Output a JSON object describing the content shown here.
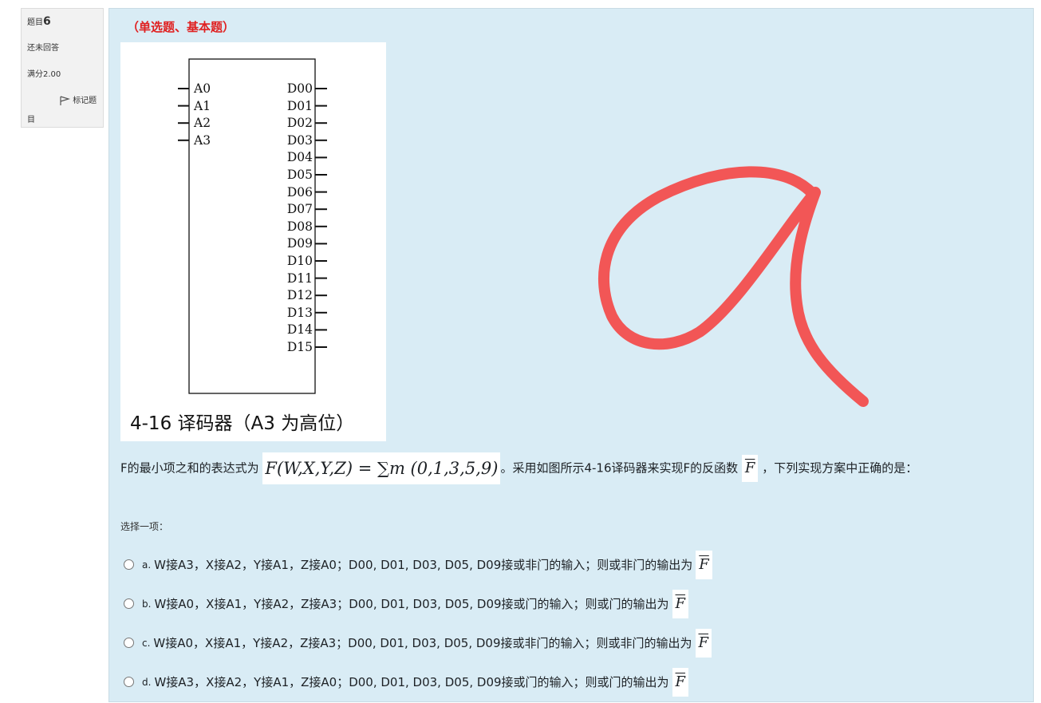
{
  "info": {
    "question_label": "题目",
    "question_number": "6",
    "status": "还未回答",
    "grade": "满分2.00",
    "flag_label": "标记题目"
  },
  "question": {
    "type_label": "（单选题、基本题）",
    "figure": {
      "inputs": [
        "A0",
        "A1",
        "A2",
        "A3"
      ],
      "outputs": [
        "D00",
        "D01",
        "D02",
        "D03",
        "D04",
        "D05",
        "D06",
        "D07",
        "D08",
        "D09",
        "D10",
        "D11",
        "D12",
        "D13",
        "D14",
        "D15"
      ],
      "caption": "4-16 译码器（A3 为高位）"
    },
    "stem_prefix": "F的最小项之和的表达式为",
    "formula": "F(W,X,Y,Z) = ∑m (0,1,3,5,9)",
    "stem_middle": "。采用如图所示4-16译码器来实现F的反函数",
    "f_symbol": "F",
    "stem_suffix": "，下列实现方案中正确的是：",
    "prompt": "选择一项："
  },
  "options": [
    {
      "letter": "a.",
      "text": "W接A3，X接A2，Y接A1，Z接A0；D00, D01, D03, D05, D09接或非门的输入；则或非门的输出为",
      "f": "F"
    },
    {
      "letter": "b.",
      "text": "W接A0，X接A1，Y接A2，Z接A3；D00, D01, D03, D05, D09接或门的输入；则或门的输出为",
      "f": "F"
    },
    {
      "letter": "c.",
      "text": "W接A0，X接A1，Y接A2，Z接A3；D00, D01, D03, D05, D09接或非门的输入；则或非门的输出为",
      "f": "F"
    },
    {
      "letter": "d.",
      "text": "W接A3，X接A2，Y接A1，Z接A0；D00, D01, D03, D05, D09接或门的输入；则或门的输出为",
      "f": "F"
    }
  ],
  "colors": {
    "panel_bg": "#d9ecf5",
    "type_label": "#e02020",
    "annotation_stroke": "#f25656"
  },
  "annotation": {
    "kind": "handwritten-red-stroke",
    "depicts": "letter a"
  }
}
